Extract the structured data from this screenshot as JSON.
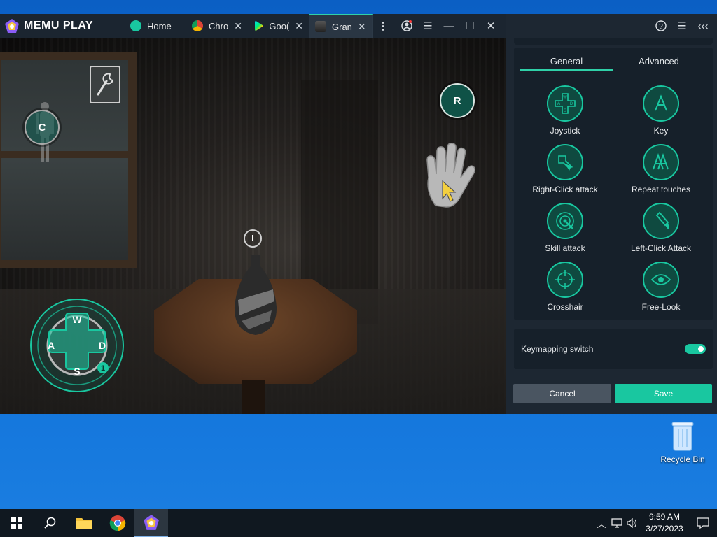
{
  "app": {
    "logo_text": "MEMU PLAY",
    "tabs": [
      {
        "label": "Home",
        "icon": "memu-home-icon",
        "closable": false
      },
      {
        "label": "Chro",
        "icon": "chrome-icon",
        "closable": true
      },
      {
        "label": "Goo(",
        "icon": "play-store-icon",
        "closable": true
      },
      {
        "label": "Gran",
        "icon": "granny-game-icon",
        "closable": true,
        "active": true
      }
    ],
    "accent_color": "#19c7a0"
  },
  "hud": {
    "c_key": "C",
    "r_key": "R",
    "joystick": {
      "up": "W",
      "left": "A",
      "right": "D",
      "down": "S",
      "badge": "1"
    }
  },
  "panel": {
    "tabs": [
      "General",
      "Advanced"
    ],
    "active_tab": "General",
    "tools": [
      {
        "label": "Joystick",
        "icon": "joystick-icon"
      },
      {
        "label": "Key",
        "icon": "key-icon"
      },
      {
        "label": "Right-Click attack",
        "icon": "right-click-attack-icon"
      },
      {
        "label": "Repeat touches",
        "icon": "repeat-touches-icon"
      },
      {
        "label": "Skill attack",
        "icon": "skill-attack-icon"
      },
      {
        "label": "Left-Click Attack",
        "icon": "left-click-attack-icon"
      },
      {
        "label": "Crosshair",
        "icon": "crosshair-icon"
      },
      {
        "label": "Free-Look",
        "icon": "free-look-icon"
      }
    ],
    "switch_label": "Keymapping switch",
    "switch_on": true,
    "cancel_label": "Cancel",
    "save_label": "Save"
  },
  "desktop": {
    "recycle_bin_label": "Recycle Bin"
  },
  "taskbar": {
    "time": "9:59 AM",
    "date": "3/27/2023"
  }
}
